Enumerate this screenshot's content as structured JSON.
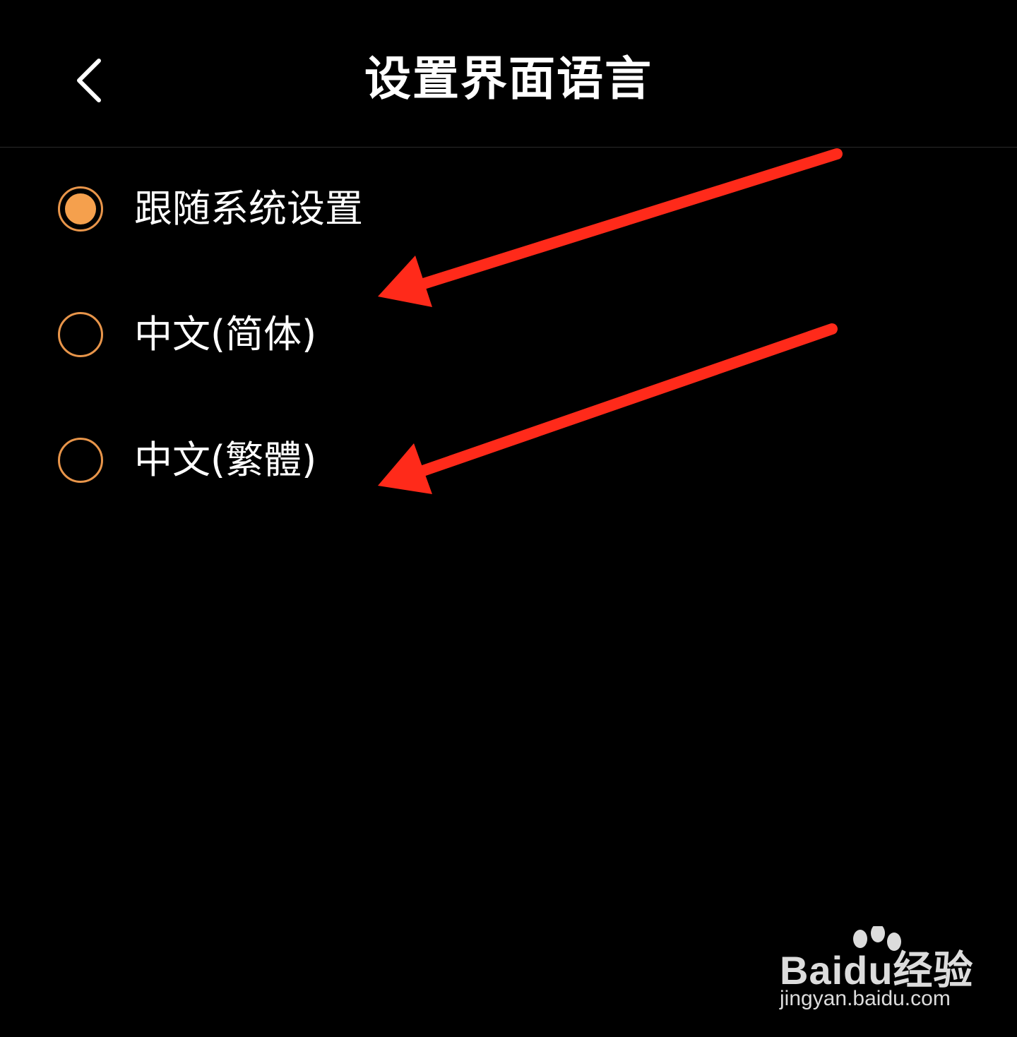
{
  "header": {
    "title": "设置界面语言",
    "back_icon": "chevron-left-icon"
  },
  "options": [
    {
      "label": "跟随系统设置",
      "checked": true
    },
    {
      "label": "中文(简体)",
      "checked": false
    },
    {
      "label": "中文(繁體)",
      "checked": false
    }
  ],
  "colors": {
    "background": "#000000",
    "accent": "#f5a04d",
    "radio_border": "#e8954a",
    "annotation_arrow": "#ff2a1a",
    "text": "#ffffff"
  },
  "watermark": {
    "brand": "Baidu经验",
    "url": "jingyan.baidu.com"
  }
}
